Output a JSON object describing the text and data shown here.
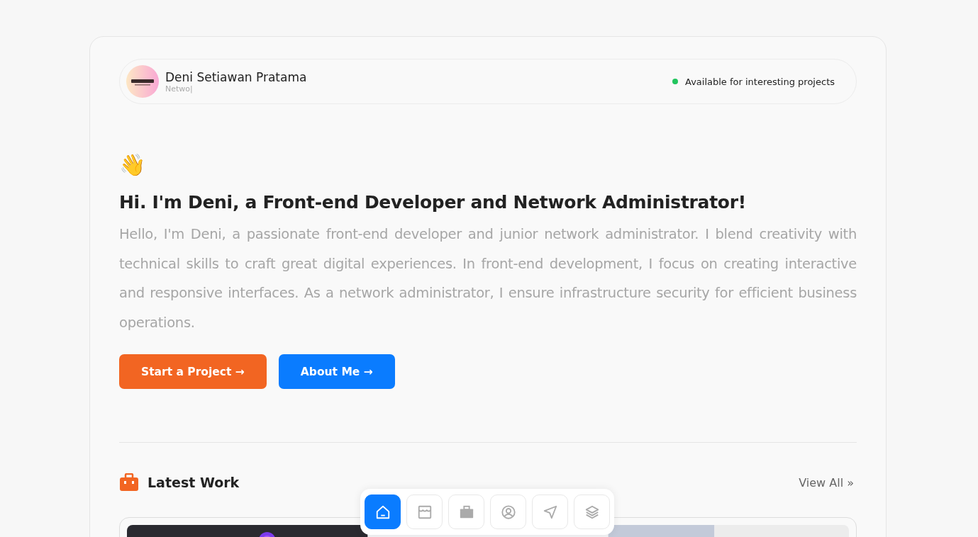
{
  "header": {
    "name": "Deni Setiawan Pratama",
    "subtitle": "Netwo|",
    "status": "Available for interesting projects"
  },
  "hero": {
    "emoji": "👋",
    "title": "Hi. I'm Deni, a Front-end Developer and Network Administrator!",
    "intro": "Hello, I'm Deni, a passionate front-end developer and junior network administrator. I blend creativity with technical skills to craft great digital experiences. In front-end development, I focus on creating interactive and responsive interfaces. As a network administrator, I ensure infrastructure security for efficient business operations.",
    "buttons": [
      {
        "label": "Start a Project →",
        "kind": "primary"
      },
      {
        "label": "About Me →",
        "kind": "secondary"
      }
    ]
  },
  "latest_work": {
    "title": "Latest Work",
    "link": "View All »"
  },
  "dock": [
    {
      "kind": "home",
      "selected": true
    },
    {
      "kind": "store",
      "selected": false
    },
    {
      "kind": "briefcase",
      "selected": false
    },
    {
      "kind": "user",
      "selected": false
    },
    {
      "kind": "send",
      "selected": false
    },
    {
      "kind": "layers",
      "selected": false
    }
  ]
}
